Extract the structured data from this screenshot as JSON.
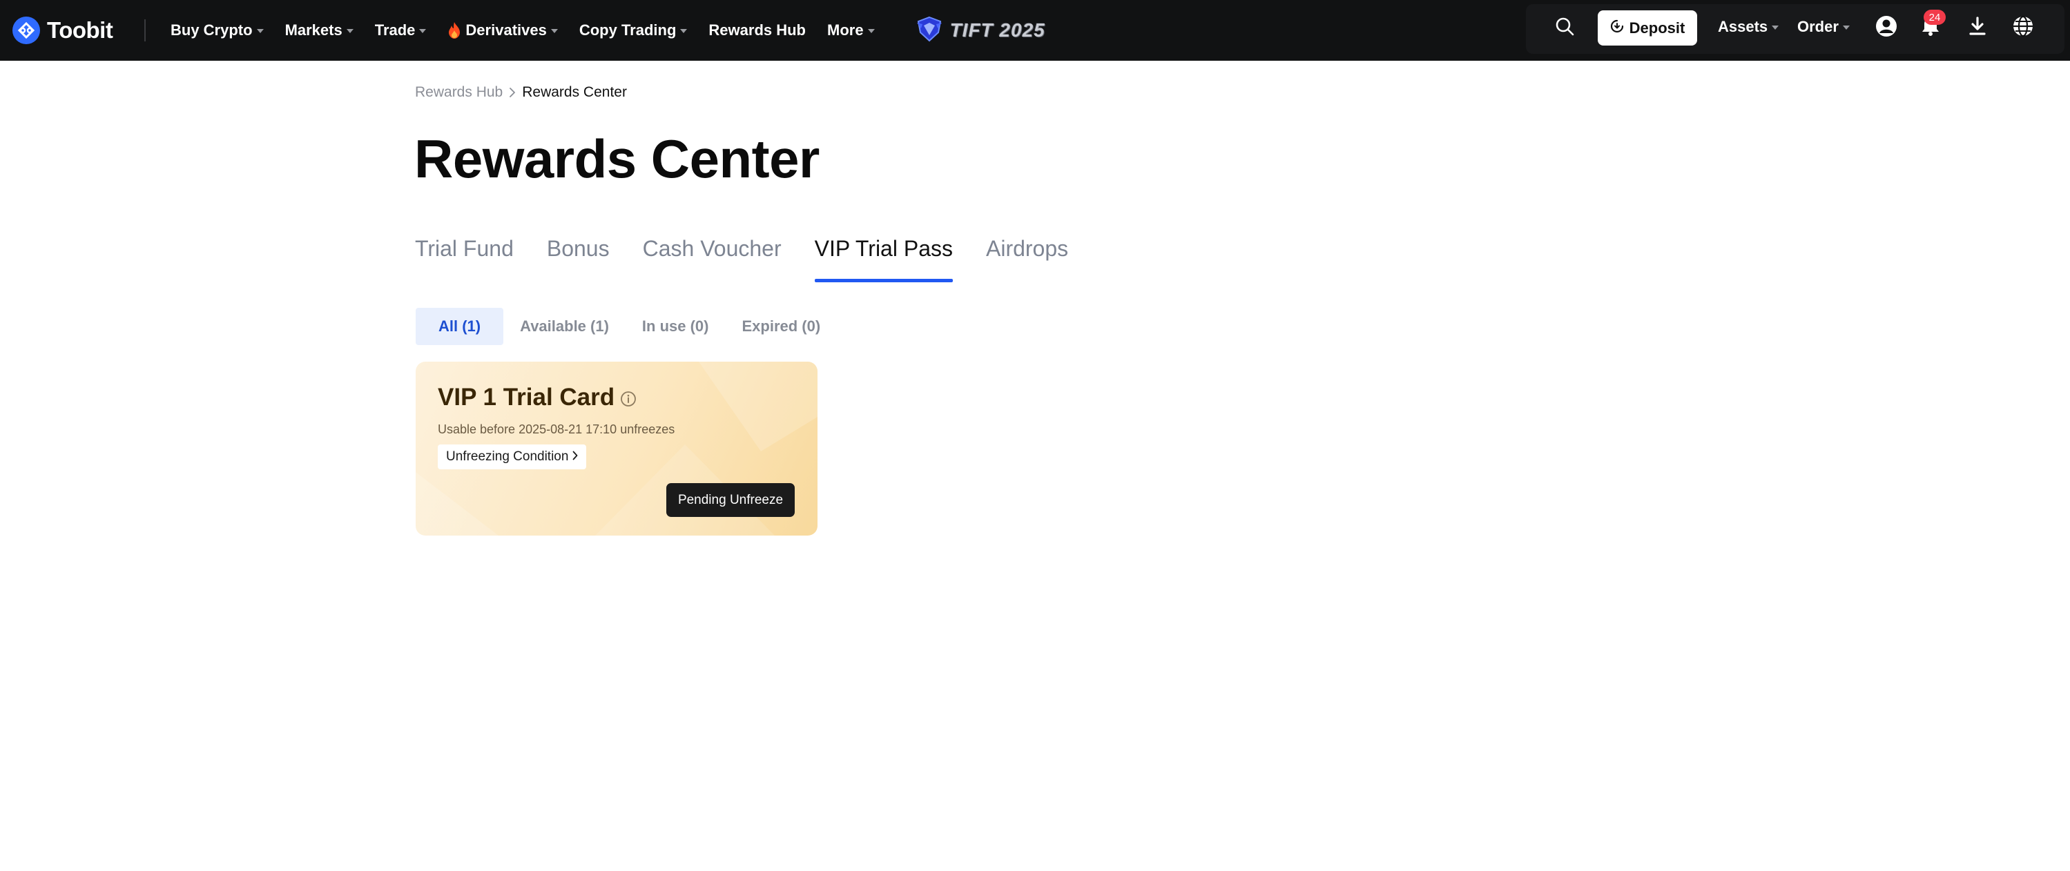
{
  "nav": {
    "logo_text": "Toobit",
    "items": [
      {
        "label": "Buy Crypto"
      },
      {
        "label": "Markets"
      },
      {
        "label": "Trade"
      },
      {
        "label": "Derivatives"
      },
      {
        "label": "Copy Trading"
      },
      {
        "label": "Rewards Hub"
      },
      {
        "label": "More"
      }
    ],
    "banner_text": "TIFT 2025",
    "deposit_label": "Deposit",
    "assets_label": "Assets",
    "order_label": "Order",
    "notification_count": "24"
  },
  "breadcrumb": {
    "parent": "Rewards Hub",
    "current": "Rewards Center"
  },
  "page": {
    "title": "Rewards Center"
  },
  "tabs": [
    {
      "label": "Trial Fund",
      "active": false
    },
    {
      "label": "Bonus",
      "active": false
    },
    {
      "label": "Cash Voucher",
      "active": false
    },
    {
      "label": "VIP Trial Pass",
      "active": true
    },
    {
      "label": "Airdrops",
      "active": false
    }
  ],
  "filters": [
    {
      "label": "All (1)",
      "active": true
    },
    {
      "label": "Available (1)",
      "active": false
    },
    {
      "label": "In use (0)",
      "active": false
    },
    {
      "label": "Expired (0)",
      "active": false
    }
  ],
  "card": {
    "title": "VIP 1 Trial Card",
    "subtitle": "Usable before 2025-08-21 17:10 unfreezes",
    "condition_label": "Unfreezing Condition",
    "action_label": "Pending Unfreeze"
  },
  "colors": {
    "accent": "#2158f2",
    "topbar": "#111213",
    "badge": "#f23b4a",
    "card_gradient_start": "#fdf1dc",
    "card_gradient_end": "#f8d99c"
  }
}
